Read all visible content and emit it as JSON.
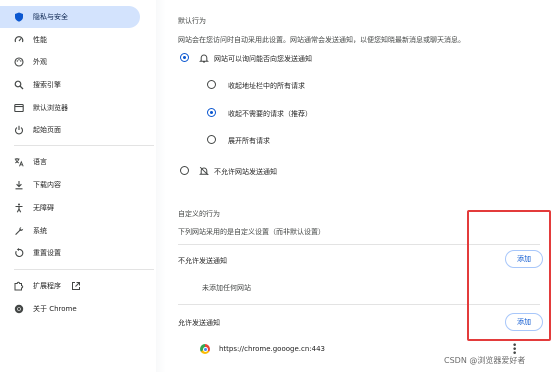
{
  "sidebar": {
    "items": [
      {
        "label": "隐私与安全",
        "icon": "shield-icon"
      },
      {
        "label": "性能",
        "icon": "speedometer-icon"
      },
      {
        "label": "外观",
        "icon": "palette-icon"
      },
      {
        "label": "搜索引擎",
        "icon": "search-icon"
      },
      {
        "label": "默认浏览器",
        "icon": "browser-window-icon"
      },
      {
        "label": "起始页面",
        "icon": "power-icon"
      },
      {
        "label": "语言",
        "icon": "translate-icon"
      },
      {
        "label": "下载内容",
        "icon": "download-icon"
      },
      {
        "label": "无障碍",
        "icon": "accessibility-icon"
      },
      {
        "label": "系统",
        "icon": "wrench-icon"
      },
      {
        "label": "重置设置",
        "icon": "reset-icon"
      },
      {
        "label": "扩展程序",
        "icon": "puzzle-icon"
      },
      {
        "label": "关于 Chrome",
        "icon": "chrome-logo-icon"
      }
    ],
    "active_index": 0
  },
  "default_behavior": {
    "title": "默认行为",
    "description": "网站会在您访问时自动采用此设置。网站通常会发送通知，以便您知晓最新消息或聊天消息。",
    "allow_option": "网站可以询问能否向您发送通知",
    "sub_options": [
      {
        "label": "收起地址栏中的所有请求",
        "checked": false
      },
      {
        "label": "收起不需要的请求（推荐）",
        "checked": true
      },
      {
        "label": "展开所有请求",
        "checked": false
      }
    ],
    "block_option": "不允许网站发送通知"
  },
  "custom_behavior": {
    "title": "自定义的行为",
    "description": "下列网站采用的是自定义设置（而非默认设置）",
    "block_list": {
      "title": "不允许发送通知",
      "add_label": "添加",
      "empty_text": "未添加任何网站"
    },
    "allow_list": {
      "title": "允许发送通知",
      "add_label": "添加",
      "sites": [
        "https://chrome.goooge.cn:443"
      ]
    }
  },
  "watermark": "CSDN @浏览器爱好者",
  "colors": {
    "accent": "#0b57d0",
    "active_nav_bg": "#d3e3fd",
    "highlight_box": "#e33b3b"
  }
}
